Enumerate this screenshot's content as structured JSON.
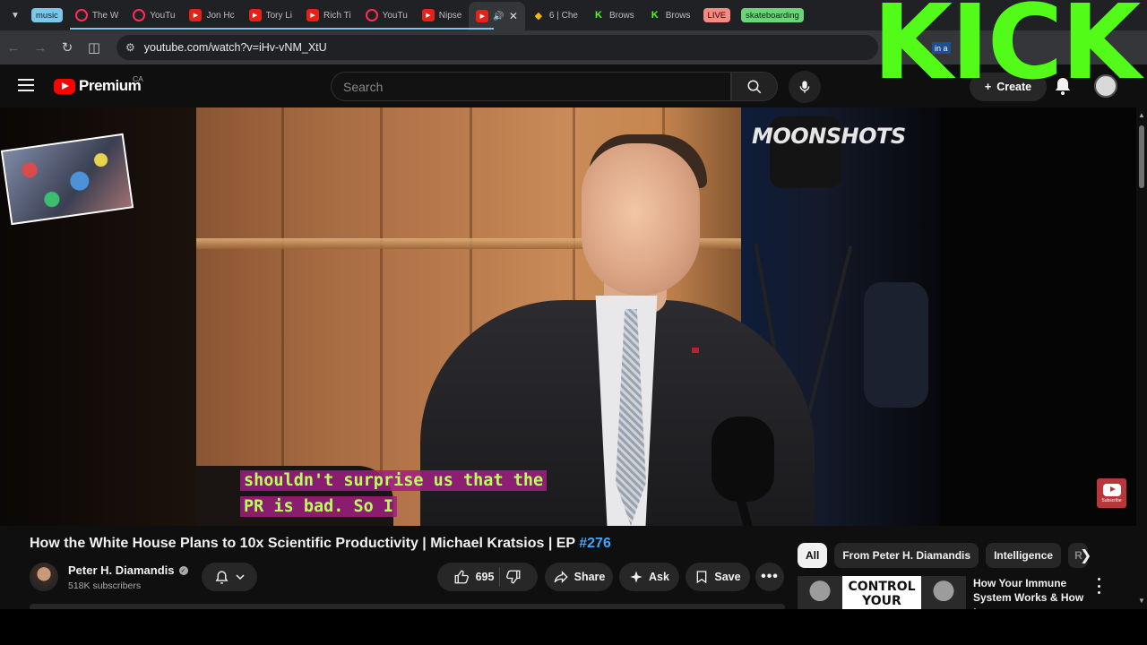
{
  "browser": {
    "tabs": [
      {
        "label": "music",
        "kind": "group-music"
      },
      {
        "label": "The W",
        "icon": "youtube-icon"
      },
      {
        "label": "YouTu",
        "icon": "youtube-music-icon"
      },
      {
        "label": "Jon Hc",
        "icon": "youtube-icon"
      },
      {
        "label": "Tory Li",
        "icon": "youtube-icon"
      },
      {
        "label": "Rich Ti",
        "icon": "youtube-icon"
      },
      {
        "label": "YouTu",
        "icon": "youtube-music-icon"
      },
      {
        "label": "Nipse",
        "icon": "youtube-icon"
      },
      {
        "label": "",
        "icon": "youtube-icon",
        "active": true
      },
      {
        "label": "6 | Che",
        "icon": "binance-icon"
      },
      {
        "label": "Brows",
        "icon": "kick-icon"
      },
      {
        "label": "Brows",
        "icon": "kick-icon"
      },
      {
        "label": "LIVE",
        "kind": "group-live"
      },
      {
        "label": "skateboarding",
        "kind": "group-skate"
      }
    ],
    "url": "youtube.com/watch?v=iHv-vNM_XtU"
  },
  "overlay": {
    "kick_text": "KICK",
    "badge_text": "in a",
    "kick_color": "#53fc18"
  },
  "masthead": {
    "logo_text": "Premium",
    "country_code": "CA",
    "search_placeholder": "Search",
    "create_label": "Create"
  },
  "video": {
    "watermark": "MOONSHOTS",
    "subtitle": "shouldn't surprise us that the PR is bad. So I",
    "subscribe_watermark": "Subscribe"
  },
  "details": {
    "title_main": "How the White House Plans to 10x Scientific Productivity | Michael Kratsios | EP ",
    "title_tag": "#276",
    "channel": "Peter H. Diamandis",
    "subscribers": "518K subscribers",
    "likes": "695",
    "share_label": "Share",
    "ask_label": "Ask",
    "save_label": "Save"
  },
  "sidebar": {
    "chips": [
      "All",
      "From Peter H. Diamandis",
      "Intelligence",
      "R"
    ],
    "rec": {
      "thumb_text": "CONTROL YOUR",
      "title": "How Your Immune System Works & How t..."
    }
  },
  "colors": {
    "accent_blue": "#3ea6ff",
    "subtitle_fg": "#b7ff5a",
    "subtitle_bg": "#a01e82",
    "yt_red": "#ff0000"
  }
}
